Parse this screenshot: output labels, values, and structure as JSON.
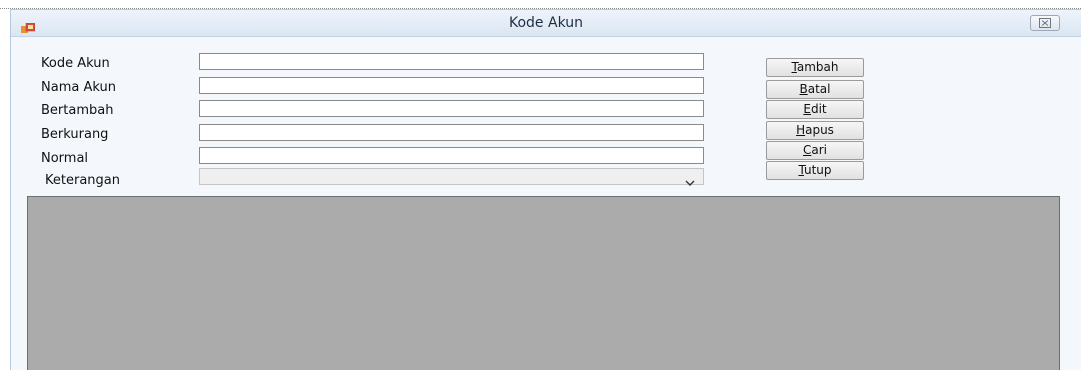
{
  "window": {
    "title": "Kode Akun"
  },
  "form": {
    "fields": [
      {
        "label": "Kode Akun",
        "value": ""
      },
      {
        "label": "Nama Akun",
        "value": ""
      },
      {
        "label": "Bertambah",
        "value": ""
      },
      {
        "label": "Berkurang",
        "value": ""
      },
      {
        "label": "Normal",
        "value": ""
      }
    ],
    "keterangan": {
      "label": "Keterangan",
      "value": ""
    }
  },
  "buttons": [
    {
      "accel": "T",
      "rest": "ambah"
    },
    {
      "accel": "B",
      "rest": "atal"
    },
    {
      "accel": "E",
      "rest": "dit"
    },
    {
      "accel": "H",
      "rest": "apus"
    },
    {
      "accel": "C",
      "rest": "ari"
    },
    {
      "accel": "T",
      "rest": "utup"
    }
  ],
  "icons": {
    "app": "app-icon",
    "close": "close-icon",
    "dropdown": "chevron-down-icon"
  }
}
